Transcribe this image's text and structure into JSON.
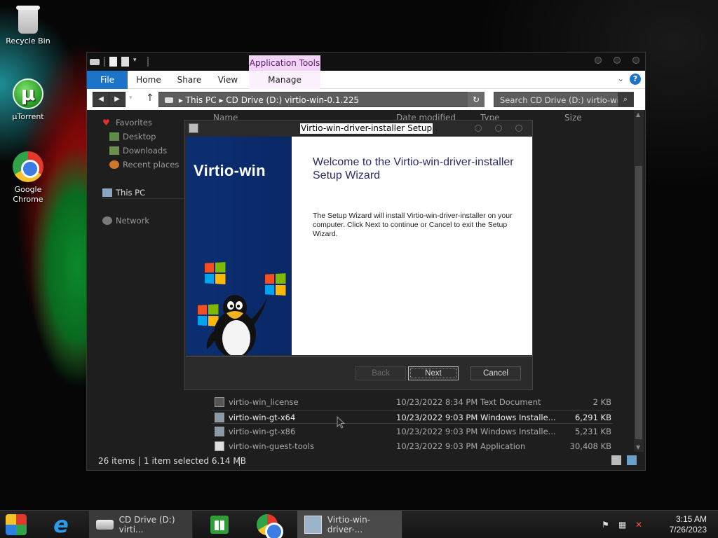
{
  "desktop": {
    "icons": [
      {
        "label": "Recycle Bin",
        "icon": "recycle-bin-icon"
      },
      {
        "label": "µTorrent",
        "icon": "utorrent-icon"
      },
      {
        "label": "Google Chrome",
        "icon": "chrome-icon"
      }
    ]
  },
  "explorer": {
    "app_tools_label": "Application Tools",
    "tabs": {
      "file": "File",
      "home": "Home",
      "share": "Share",
      "view": "View",
      "manage": "Manage"
    },
    "address": {
      "this_pc": "This PC",
      "drive": "CD Drive (D:) virtio-win-0.1.225"
    },
    "search_placeholder": "Search CD Drive (D:) virtio-wi...",
    "nav": {
      "favorites": "Favorites",
      "desktop": "Desktop",
      "downloads": "Downloads",
      "recent": "Recent places",
      "this_pc": "This PC",
      "network": "Network"
    },
    "columns": {
      "name": "Name",
      "date": "Date modified",
      "type": "Type",
      "size": "Size"
    },
    "files": [
      {
        "name": "virtio-win_license",
        "date": "10/23/2022 8:34 PM",
        "type": "Text Document",
        "size": "2 KB"
      },
      {
        "name": "virtio-win-gt-x64",
        "date": "10/23/2022 9:03 PM",
        "type": "Windows Installe...",
        "size": "6,291 KB"
      },
      {
        "name": "virtio-win-gt-x86",
        "date": "10/23/2022 9:03 PM",
        "type": "Windows Installe...",
        "size": "5,231 KB"
      },
      {
        "name": "virtio-win-guest-tools",
        "date": "10/23/2022 9:03 PM",
        "type": "Application",
        "size": "30,408 KB"
      }
    ],
    "status": {
      "count": "26 items",
      "selected": "1 item selected  6.14 MB"
    }
  },
  "setup": {
    "title": "Virtio-win-driver-installer Setup",
    "brand": "Virtio-win",
    "welcome_title": "Welcome to the Virtio-win-driver-installer Setup Wizard",
    "welcome_body": "The Setup Wizard will install Virtio-win-driver-installer on your computer. Click Next to continue or Cancel to exit the Setup Wizard.",
    "buttons": {
      "back": "Back",
      "next": "Next",
      "cancel": "Cancel"
    }
  },
  "taskbar": {
    "explorer_label": "CD Drive (D:) virti...",
    "setup_label": "Virtio-win-driver-...",
    "time": "3:15 AM",
    "date": "7/26/2023"
  }
}
